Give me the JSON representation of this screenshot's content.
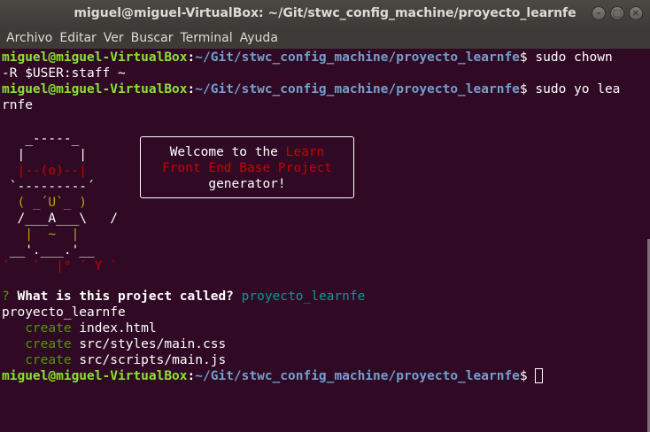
{
  "window": {
    "title": "miguel@miguel-VirtualBox: ~/Git/stwc_config_machine/proyecto_learnfe",
    "controls": {
      "minimize": "–",
      "maximize": "□",
      "close": "×"
    }
  },
  "menu": [
    "Archivo",
    "Editar",
    "Ver",
    "Buscar",
    "Terminal",
    "Ayuda"
  ],
  "prompt": {
    "user": "miguel@miguel-VirtualBox",
    "path": "~/Git/stwc_config_machine/proyecto_learnfe",
    "symbol": "$ "
  },
  "commands": [
    {
      "first": "sudo chown",
      "cont": "-R $USER:staff ~"
    },
    {
      "first": "sudo yo lea",
      "cont": "rnfe"
    }
  ],
  "yeoman": {
    "art": [
      "   _-----_",
      "  |       |",
      "  |--(o)--|",
      " `---------´",
      "  ( _´U`_ )",
      "  /___A___\\   /",
      "   |  ~  |",
      " __'.___.'__",
      "´   `  |° ´ Y `"
    ],
    "greeting": "Welcome to the ",
    "highlight1": "Learn",
    "highlight2": "Front End Base Project",
    "greeting_end": "generator!"
  },
  "question": {
    "mark": "?",
    "text": "What is this project called?",
    "answer": "proyecto_learnfe"
  },
  "output": {
    "echo": "proyecto_learnfe",
    "actions": [
      {
        "verb": "create",
        "file": "index.html"
      },
      {
        "verb": "create",
        "file": "src/styles/main.css"
      },
      {
        "verb": "create",
        "file": "src/scripts/main.js"
      }
    ]
  },
  "colors": {
    "background": "#300a24",
    "prompt_user": "#8ae234",
    "prompt_path": "#729fcf",
    "red": "#cc0000",
    "yellow": "#c4a000",
    "green": "#4e9a06",
    "cyan": "#06989a"
  }
}
